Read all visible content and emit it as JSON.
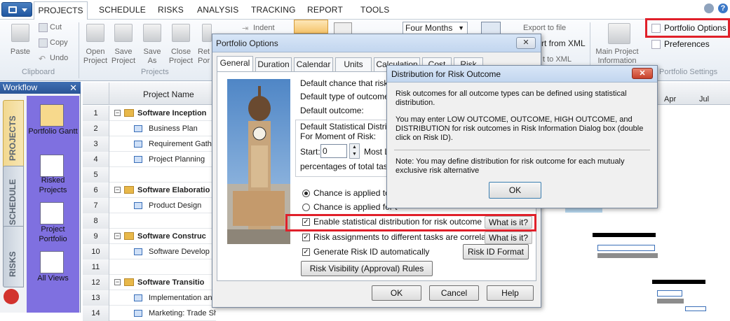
{
  "ribbon_tabs": [
    "PROJECTS",
    "SCHEDULE",
    "RISKS",
    "ANALYSIS",
    "TRACKING",
    "REPORT",
    "TOOLS"
  ],
  "clipboard": {
    "paste": "Paste",
    "cut": "Cut",
    "copy": "Copy",
    "undo": "Undo",
    "group": "Clipboard"
  },
  "projects_group": {
    "open": "Open Project",
    "save": "Save Project",
    "save_as": "Save As",
    "close": "Close Project",
    "ret": "Ret",
    "por": "Por",
    "group": "Projects"
  },
  "indent": "Indent",
  "period_select": "Four Months",
  "export_file": "Export to file",
  "from_xml": "rt from XML",
  "to_xml": "t to XML",
  "main_info": "Main Project Information",
  "portfolio_options": "Portfolio Options",
  "preferences": "Preferences",
  "portfolio_settings": "Portfolio Settings",
  "workflow": {
    "title": "Workflow",
    "tabs": [
      "PROJECTS",
      "SCHEDULE",
      "RISKS"
    ],
    "items": [
      "Portfolio Gantt",
      "Risked Projects",
      "Project Portfolio",
      "All Views"
    ]
  },
  "grid": {
    "header": "Project Name",
    "rows": [
      {
        "n": "1",
        "name": "Software Inception",
        "type": "group"
      },
      {
        "n": "2",
        "name": "Business Plan",
        "type": "task"
      },
      {
        "n": "3",
        "name": "Requirement Gath",
        "type": "task"
      },
      {
        "n": "4",
        "name": "Project Planning",
        "type": "task"
      },
      {
        "n": "5",
        "name": "",
        "type": "empty"
      },
      {
        "n": "6",
        "name": "Software Elaboratio",
        "type": "group"
      },
      {
        "n": "7",
        "name": "Product Design",
        "type": "task"
      },
      {
        "n": "8",
        "name": "",
        "type": "empty"
      },
      {
        "n": "9",
        "name": "Software Construc",
        "type": "group"
      },
      {
        "n": "10",
        "name": "Software Develop",
        "type": "task"
      },
      {
        "n": "11",
        "name": "",
        "type": "empty"
      },
      {
        "n": "12",
        "name": "Software Transitio",
        "type": "group"
      },
      {
        "n": "13",
        "name": "Implementation and",
        "type": "task"
      },
      {
        "n": "14",
        "name": "Marketing: Trade Sh",
        "type": "task"
      }
    ]
  },
  "gantt_months": [
    "Apr",
    "Jul"
  ],
  "dialog1": {
    "title": "Portfolio Options",
    "tabs": [
      "General",
      "Duration",
      "Calendar",
      "Units",
      "Calculation",
      "Cost",
      "Risk"
    ],
    "line1": "Default chance that risk w",
    "line2": "Default type of outcome:",
    "line3": "Default outcome:",
    "stat_group1": "Default Statistical Distributi",
    "stat_group2": "For Moment of Risk:",
    "start_label": "Start:",
    "start_value": "0",
    "most_label": "Most L",
    "pct_line": "percentages of total task d",
    "radio1": "Chance is applied to th",
    "radio2": "Chance is applied for t",
    "chk1": "Enable statistical distribution for risk outcome",
    "chk2": "Risk assignments to different tasks are correlated",
    "chk3": "Generate Risk ID automatically",
    "what1": "What is it?",
    "what2": "What is it?",
    "risk_id_format": "Risk ID Format",
    "visibility": "Risk Visibility (Approval) Rules",
    "ok": "OK",
    "cancel": "Cancel",
    "help": "Help"
  },
  "dialog2": {
    "title": "Distribution for Risk Outcome",
    "p1": "Risk outcomes for all outcome types can be defined using statistical distribution.",
    "p2": "You may enter LOW OUTCOME, OUTCOME, HIGH OUTCOME, and DISTRIBUTION for risk outcomes in Risk Information Dialog box (double click on Risk ID).",
    "p3": "Note: You may define distribution for risk outcome for each mutualy exclusive risk alternative",
    "ok": "OK"
  },
  "colors": {
    "highlight": "#e0202a",
    "workflow_panel": "#7f70e0",
    "title_bar": "#2a5596"
  }
}
